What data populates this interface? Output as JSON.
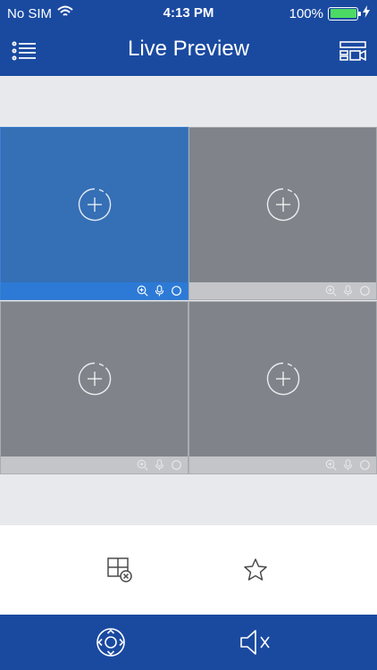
{
  "status_bar": {
    "carrier": "No SIM",
    "time": "4:13 PM",
    "battery_percent": "100%",
    "wifi_icon": "wifi-icon",
    "charging_icon": "charging-bolt-icon",
    "battery_level": 1.0,
    "battery_color": "#4cd964"
  },
  "nav": {
    "title": "Live Preview",
    "left_icon": "menu-list-icon",
    "right_icon": "device-layout-icon"
  },
  "grid": {
    "selected_index": 0,
    "cells": [
      {
        "add_icon": "add-circle-icon",
        "bar_icons": [
          "zoom-in-icon",
          "microphone-icon",
          "record-circle-icon"
        ]
      },
      {
        "add_icon": "add-circle-icon",
        "bar_icons": [
          "zoom-in-icon",
          "microphone-icon",
          "record-circle-icon"
        ]
      },
      {
        "add_icon": "add-circle-icon",
        "bar_icons": [
          "zoom-in-icon",
          "microphone-icon",
          "record-circle-icon"
        ]
      },
      {
        "add_icon": "add-circle-icon",
        "bar_icons": [
          "zoom-in-icon",
          "microphone-icon",
          "record-circle-icon"
        ]
      }
    ]
  },
  "toolbar": {
    "close_all_icon": "close-all-windows-icon",
    "favorite_icon": "star-icon"
  },
  "bottom_bar": {
    "ptz_icon": "ptz-direction-icon",
    "mute_icon": "speaker-muted-icon"
  },
  "colors": {
    "header_bg": "#1a4aa0",
    "selected_cell": "#356fb5",
    "selected_bar": "#2d7ad6",
    "cell_bg": "#80848a",
    "cell_bar": "#c3c5c8"
  }
}
